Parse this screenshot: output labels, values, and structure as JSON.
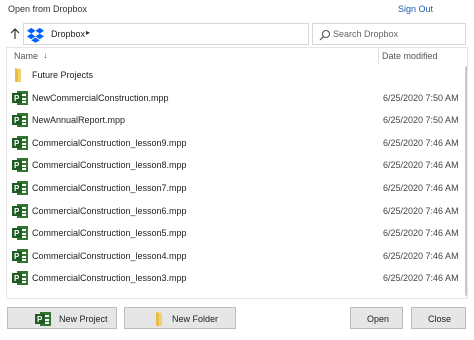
{
  "window": {
    "title": "Open from Dropbox",
    "sign_out": "Sign Out"
  },
  "nav": {
    "location": "Dropbox",
    "search_placeholder": "Search Dropbox",
    "icons": {
      "up": "up-arrow-icon",
      "dropbox": "dropbox-logo-icon",
      "refresh": "refresh-icon",
      "search": "search-icon"
    }
  },
  "columns": {
    "name": "Name",
    "date": "Date modified",
    "sort": "descending"
  },
  "files": [
    {
      "name": "Future Projects",
      "date": "",
      "type": "folder"
    },
    {
      "name": "NewCommercialConstruction.mpp",
      "date": "6/25/2020 7:50 AM",
      "type": "mpp"
    },
    {
      "name": "NewAnnualReport.mpp",
      "date": "6/25/2020 7:50 AM",
      "type": "mpp"
    },
    {
      "name": "CommercialConstruction_lesson9.mpp",
      "date": "6/25/2020 7:46 AM",
      "type": "mpp"
    },
    {
      "name": "CommercialConstruction_lesson8.mpp",
      "date": "6/25/2020 7:46 AM",
      "type": "mpp"
    },
    {
      "name": "CommercialConstruction_lesson7.mpp",
      "date": "6/25/2020 7:46 AM",
      "type": "mpp"
    },
    {
      "name": "CommercialConstruction_lesson6.mpp",
      "date": "6/25/2020 7:46 AM",
      "type": "mpp"
    },
    {
      "name": "CommercialConstruction_lesson5.mpp",
      "date": "6/25/2020 7:46 AM",
      "type": "mpp"
    },
    {
      "name": "CommercialConstruction_lesson4.mpp",
      "date": "6/25/2020 7:46 AM",
      "type": "mpp"
    },
    {
      "name": "CommercialConstruction_lesson3.mpp",
      "date": "6/25/2020 7:46 AM",
      "type": "mpp"
    }
  ],
  "footer": {
    "new_project": "New Project",
    "new_folder": "New Folder",
    "open": "Open",
    "close": "Close"
  },
  "colors": {
    "link": "#1a5fb4",
    "project_green": "#31752f",
    "folder_yellow": "#f3d26b",
    "dropbox_blue": "#0061fe"
  }
}
